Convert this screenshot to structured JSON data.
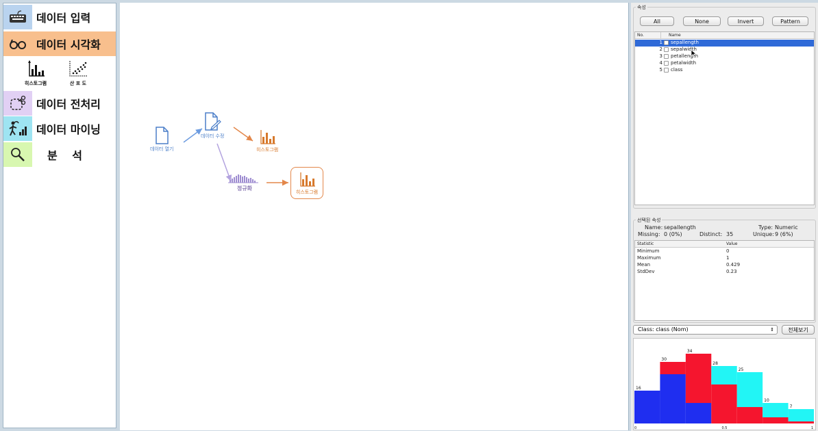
{
  "sidebar": {
    "items": [
      {
        "label": "데이터 입력",
        "icon": "keyboard-icon",
        "bg": "#b9d3ef"
      },
      {
        "label": "데이터 시각화",
        "icon": "glasses-icon",
        "bg": "#f8bf8d"
      },
      {
        "label": "데이터 전처리",
        "icon": "scissors-icon",
        "bg": "#e1d0f4"
      },
      {
        "label": "데이터 마이닝",
        "icon": "miner-icon",
        "bg": "#9ee4f2"
      },
      {
        "label": "분  석",
        "icon": "magnifier-icon",
        "bg": "#d8f7b0"
      }
    ],
    "sub_tools": [
      {
        "label": "히스토그램",
        "icon": "histogram-icon"
      },
      {
        "label": "산 포 도",
        "icon": "scatter-icon"
      }
    ]
  },
  "canvas": {
    "nodes": [
      {
        "label": "데이터 열기",
        "icon": "document-icon",
        "color": "#4b7fc9"
      },
      {
        "label": "데이터 수정",
        "icon": "edit-document-icon",
        "color": "#4b7fc9"
      },
      {
        "label": "히스토그램",
        "icon": "histogram-icon",
        "color": "#d7792c"
      },
      {
        "label": "정규화",
        "icon": "normalize-icon",
        "color": "#8c7bb5"
      },
      {
        "label": "히스토그램",
        "icon": "histogram-icon",
        "color": "#d7792c"
      }
    ]
  },
  "attributes": {
    "group_label": "속성",
    "buttons": [
      "All",
      "None",
      "Invert",
      "Pattern"
    ],
    "headers": [
      "No.",
      "Name"
    ],
    "rows": [
      {
        "no": "1",
        "name": "sepallength",
        "selected": true
      },
      {
        "no": "2",
        "name": "sepalwidth",
        "selected": false
      },
      {
        "no": "3",
        "name": "petallength",
        "selected": false
      },
      {
        "no": "4",
        "name": "petalwidth",
        "selected": false
      },
      {
        "no": "5",
        "name": "class",
        "selected": false
      }
    ]
  },
  "selected": {
    "group_label": "선택된 속성",
    "name_label": "Name:",
    "name": "sepallength",
    "type_label": "Type:",
    "type": "Numeric",
    "missing_label": "Missing:",
    "missing": "0 (0%)",
    "distinct_label": "Distinct:",
    "distinct": "35",
    "unique_label": "Unique:",
    "unique": "9 (6%)",
    "headers": [
      "Statistic",
      "Value"
    ],
    "stats": [
      {
        "statistic": "Minimum",
        "value": "0"
      },
      {
        "statistic": "Maximum",
        "value": "1"
      },
      {
        "statistic": "Mean",
        "value": "0.429"
      },
      {
        "statistic": "StdDev",
        "value": "0.23"
      }
    ]
  },
  "class_select": {
    "value": "Class: class (Nom)",
    "view_all": "전체보기"
  },
  "chart_data": {
    "type": "bar",
    "stacked": true,
    "x_tick_labels": [
      "0",
      "0.5",
      "1"
    ],
    "bin_totals": [
      16,
      30,
      34,
      28,
      25,
      10,
      7
    ],
    "series": [
      {
        "color": "#1f2ef0",
        "values": [
          16,
          24,
          10,
          0,
          0,
          0,
          0
        ]
      },
      {
        "color": "#f5152e",
        "values": [
          0,
          6,
          24,
          19,
          8,
          3,
          1
        ]
      },
      {
        "color": "#22f5f5",
        "values": [
          0,
          0,
          0,
          9,
          17,
          7,
          6
        ]
      }
    ]
  }
}
